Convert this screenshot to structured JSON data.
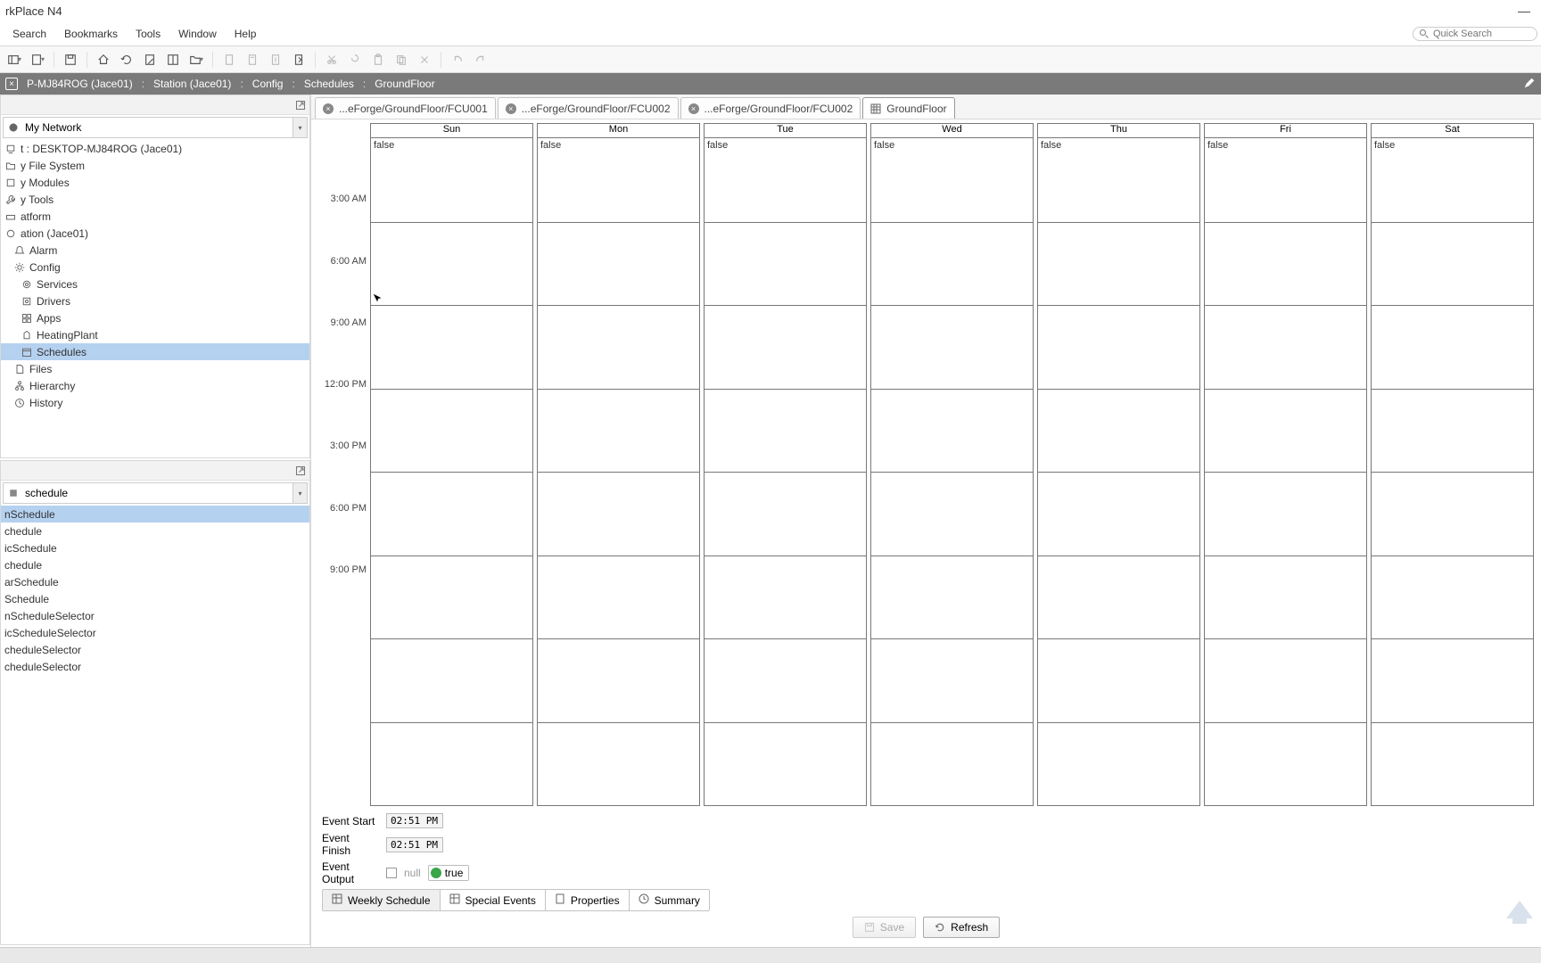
{
  "window": {
    "title": "rkPlace N4"
  },
  "menubar": {
    "items": [
      "Search",
      "Bookmarks",
      "Tools",
      "Window",
      "Help"
    ],
    "quick_search_placeholder": "Quick Search"
  },
  "breadcrumb": {
    "items": [
      "P-MJ84ROG (Jace01)",
      "Station (Jace01)",
      "Config",
      "Schedules",
      "GroundFloor"
    ]
  },
  "sidebar": {
    "network_label": "My Network",
    "tree": [
      {
        "label": "t : DESKTOP-MJ84ROG (Jace01)",
        "indent": 0,
        "icon": "host"
      },
      {
        "label": "y File System",
        "indent": 0,
        "icon": "folder"
      },
      {
        "label": "y Modules",
        "indent": 0,
        "icon": "module"
      },
      {
        "label": "y Tools",
        "indent": 0,
        "icon": "tool"
      },
      {
        "label": "atform",
        "indent": 0,
        "icon": "platform"
      },
      {
        "label": "ation (Jace01)",
        "indent": 0,
        "icon": "station"
      },
      {
        "label": "Alarm",
        "indent": 1,
        "icon": "alarm"
      },
      {
        "label": "Config",
        "indent": 1,
        "icon": "config"
      },
      {
        "label": "Services",
        "indent": 2,
        "icon": "services"
      },
      {
        "label": "Drivers",
        "indent": 2,
        "icon": "drivers"
      },
      {
        "label": "Apps",
        "indent": 2,
        "icon": "apps"
      },
      {
        "label": "HeatingPlant",
        "indent": 2,
        "icon": "plant"
      },
      {
        "label": "Schedules",
        "indent": 2,
        "icon": "schedules",
        "selected": true
      },
      {
        "label": "Files",
        "indent": 1,
        "icon": "files"
      },
      {
        "label": "Hierarchy",
        "indent": 1,
        "icon": "hierarchy"
      },
      {
        "label": "History",
        "indent": 1,
        "icon": "history"
      }
    ],
    "palette_label": "schedule",
    "palette": [
      {
        "label": "nSchedule",
        "selected": true
      },
      {
        "label": "chedule"
      },
      {
        "label": "icSchedule"
      },
      {
        "label": "chedule"
      },
      {
        "label": "arSchedule"
      },
      {
        "label": "Schedule"
      },
      {
        "label": "nScheduleSelector"
      },
      {
        "label": "icScheduleSelector"
      },
      {
        "label": "cheduleSelector"
      },
      {
        "label": "cheduleSelector"
      }
    ]
  },
  "tabs": [
    {
      "label": "...eForge/GroundFloor/FCU001",
      "closable": true
    },
    {
      "label": "...eForge/GroundFloor/FCU002",
      "closable": true
    },
    {
      "label": "...eForge/GroundFloor/FCU002",
      "closable": true
    },
    {
      "label": "GroundFloor",
      "closable": false,
      "active": true,
      "icon": "grid"
    }
  ],
  "schedule": {
    "days": [
      "Sun",
      "Mon",
      "Tue",
      "Wed",
      "Thu",
      "Fri",
      "Sat"
    ],
    "cell_value": "false",
    "time_labels": [
      "3:00 AM",
      "6:00 AM",
      "9:00 AM",
      "12:00 PM",
      "3:00 PM",
      "6:00 PM",
      "9:00 PM"
    ],
    "event_start_label": "Event Start",
    "event_start_value": "02:51 PM",
    "event_finish_label": "Event Finish",
    "event_finish_value": "02:51 PM",
    "event_output_label": "Event Output",
    "null_label": "null",
    "output_value": "true"
  },
  "sched_tabs": [
    {
      "label": "Weekly Schedule",
      "icon": "grid",
      "active": true
    },
    {
      "label": "Special Events",
      "icon": "grid"
    },
    {
      "label": "Properties",
      "icon": "doc"
    },
    {
      "label": "Summary",
      "icon": "clock"
    }
  ],
  "buttons": {
    "save": "Save",
    "refresh": "Refresh"
  }
}
